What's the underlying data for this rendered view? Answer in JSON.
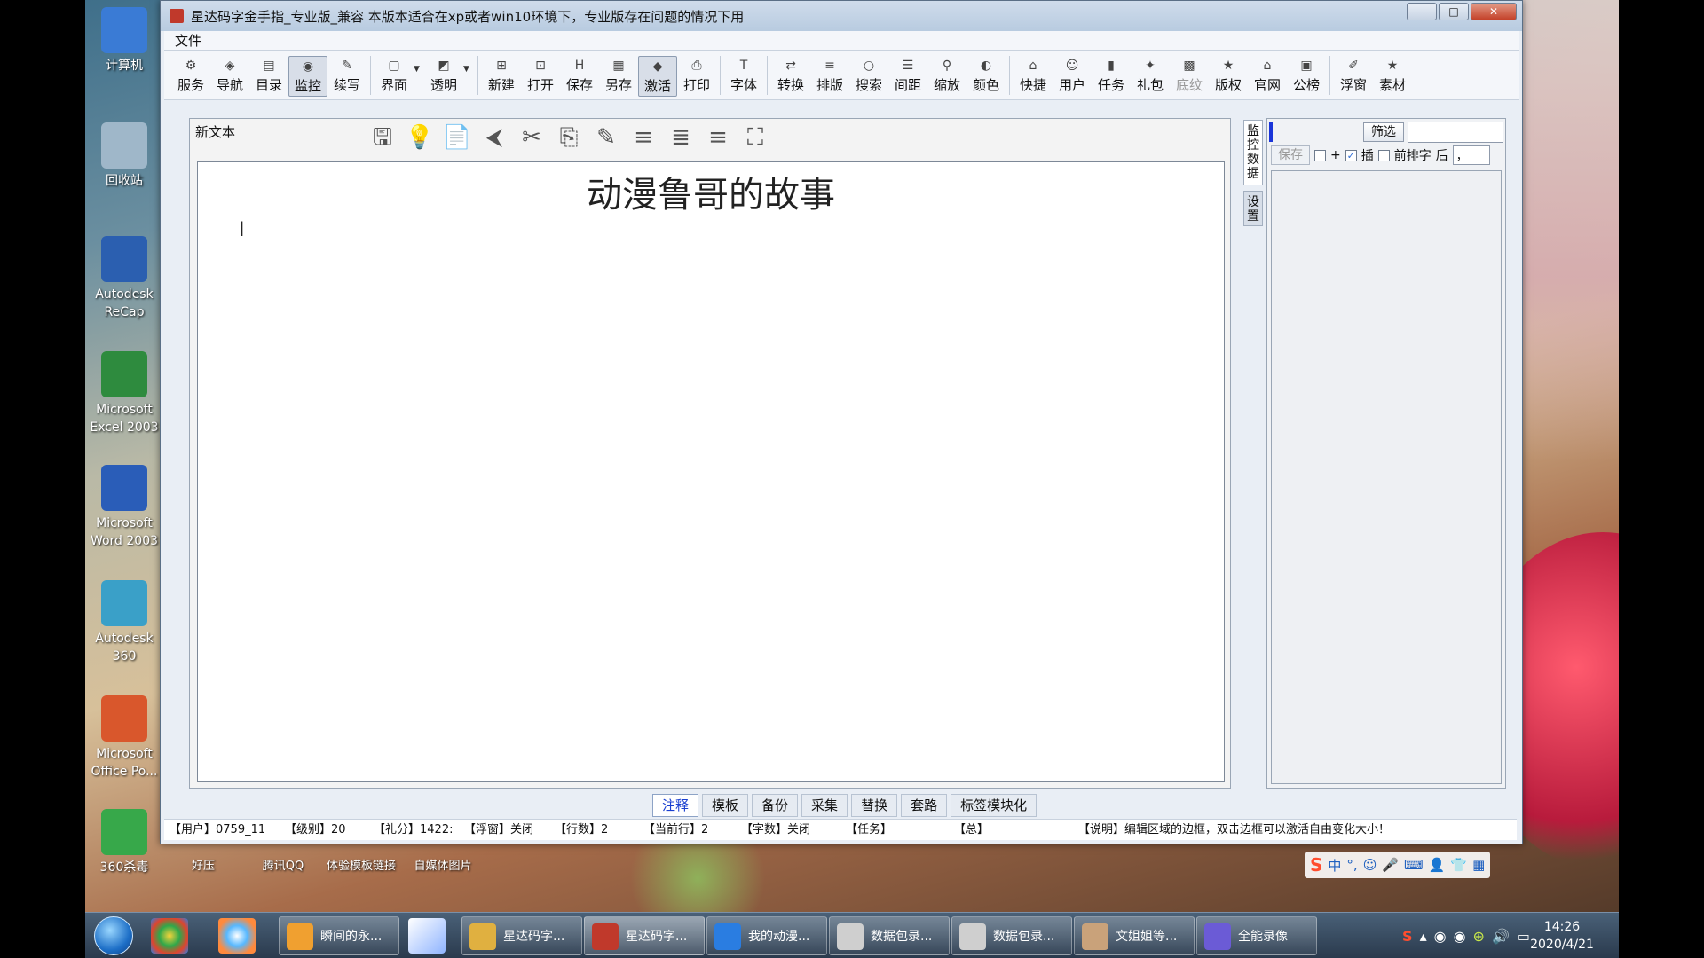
{
  "desktop": {
    "icons": [
      {
        "label": "计算机",
        "color": "#3a7bd5"
      },
      {
        "label": "回收站",
        "color": "#9fb7c9"
      },
      {
        "label": "Autodesk ReCap",
        "color": "#2b5fb0"
      },
      {
        "label": "Microsoft Excel 2003",
        "color": "#2e8b3e"
      },
      {
        "label": "Microsoft Word 2003",
        "color": "#2a5db8"
      },
      {
        "label": "Autodesk 360",
        "color": "#3aa0c8"
      },
      {
        "label": "Microsoft Office Po...",
        "color": "#d9572c"
      },
      {
        "label": "360杀毒",
        "color": "#37a84a"
      }
    ],
    "bottom_labels": [
      "好压",
      "腾讯QQ",
      "体验模板链接",
      "自媒体图片"
    ]
  },
  "window": {
    "title": "星达码字金手指_专业版_兼容 本版本适合在xp或者win10环境下，专业版存在问题的情况下用",
    "buttons": {
      "minimize": "—",
      "maximize": "□",
      "close": "✕"
    }
  },
  "menu": {
    "file": "文件"
  },
  "toolbar": {
    "groups": [
      [
        {
          "label": "服务",
          "icon": "⚙"
        },
        {
          "label": "导航",
          "icon": "◈"
        },
        {
          "label": "目录",
          "icon": "▤"
        },
        {
          "label": "监控",
          "icon": "◉",
          "active": true
        },
        {
          "label": "续写",
          "icon": "✎"
        }
      ],
      [
        {
          "label": "界面",
          "icon": "▢",
          "dropdown": true
        },
        {
          "label": "透明",
          "icon": "◩",
          "dropdown": true
        }
      ],
      [
        {
          "label": "新建",
          "icon": "⊞"
        },
        {
          "label": "打开",
          "icon": "⊡"
        },
        {
          "label": "保存",
          "icon": "H"
        },
        {
          "label": "另存",
          "icon": "▦"
        },
        {
          "label": "激活",
          "icon": "◆",
          "active": true
        },
        {
          "label": "打印",
          "icon": "⎙"
        }
      ],
      [
        {
          "label": "字体",
          "icon": "T"
        }
      ],
      [
        {
          "label": "转换",
          "icon": "⇄"
        },
        {
          "label": "排版",
          "icon": "≡"
        },
        {
          "label": "搜索",
          "icon": "○"
        },
        {
          "label": "间距",
          "icon": "☰"
        },
        {
          "label": "缩放",
          "icon": "⚲"
        },
        {
          "label": "颜色",
          "icon": "◐"
        }
      ],
      [
        {
          "label": "快捷",
          "icon": "⌂"
        },
        {
          "label": "用户",
          "icon": "☺"
        },
        {
          "label": "任务",
          "icon": "▮"
        },
        {
          "label": "礼包",
          "icon": "✦"
        },
        {
          "label": "底纹",
          "icon": "▩",
          "disabled": true
        },
        {
          "label": "版权",
          "icon": "★"
        },
        {
          "label": "官网",
          "icon": "⌂"
        },
        {
          "label": "公榜",
          "icon": "▣"
        }
      ],
      [
        {
          "label": "浮窗",
          "icon": "✐"
        },
        {
          "label": "素材",
          "icon": "★"
        }
      ]
    ]
  },
  "editor": {
    "tab_title": "新文本",
    "tools": [
      "save-icon",
      "bulb-icon",
      "page-icon",
      "back-icon",
      "cut-icon",
      "copy-icon",
      "paste-icon",
      "align-left-icon",
      "align-center-icon",
      "align-right-icon",
      "fullscreen-icon"
    ],
    "tool_glyphs": [
      "🖫",
      "💡",
      "📄",
      "⮜",
      "✂",
      "⎘",
      "✎",
      "≡",
      "≣",
      "≡",
      "⛶"
    ],
    "document_title": "动漫鲁哥的故事",
    "caret": "I"
  },
  "side_tabs": [
    "监控数据",
    "设置"
  ],
  "right_panel": {
    "filter_button": "筛选",
    "filter_value": "",
    "save_button": "保存",
    "plus_label": "+",
    "insert_label": "插",
    "prefix_label": "前排字",
    "after_label": "后",
    "after_value": "，",
    "insert_checked": "✓"
  },
  "bottom_tabs": [
    "注释",
    "模板",
    "备份",
    "采集",
    "替换",
    "套路",
    "标签模块化"
  ],
  "status": {
    "user": "【用户】0759_11",
    "level": "【级别】20",
    "points": "【礼分】1422:",
    "float": "【浮窗】关闭",
    "lines": "【行数】2",
    "current_line": "【当前行】2",
    "word_count": "【字数】关闭",
    "task": "【任务】",
    "total": "【总】",
    "note": "【说明】编辑区域的边框，双击边框可以激活自由变化大小！"
  },
  "ime": [
    "S",
    "中",
    "°,",
    "☺",
    "🎤",
    "⌨",
    "👤",
    "👕",
    "▦"
  ],
  "taskbar": {
    "tasks": [
      {
        "label": "瞬间的永...",
        "color": "#f0a030"
      },
      {
        "label": "星达码字...",
        "color": "#e0b040"
      },
      {
        "label": "星达码字...",
        "color": "#c0392b",
        "active": true
      },
      {
        "label": "我的动漫...",
        "color": "#2a7de1"
      },
      {
        "label": "数据包录...",
        "color": "#cfcfcf"
      },
      {
        "label": "数据包录...",
        "color": "#cfcfcf"
      },
      {
        "label": "文姐姐等...",
        "color": "#c9a27a"
      },
      {
        "label": "全能录像",
        "color": "#6b5bd6"
      }
    ],
    "time": "14:26",
    "date": "2020/4/21"
  }
}
